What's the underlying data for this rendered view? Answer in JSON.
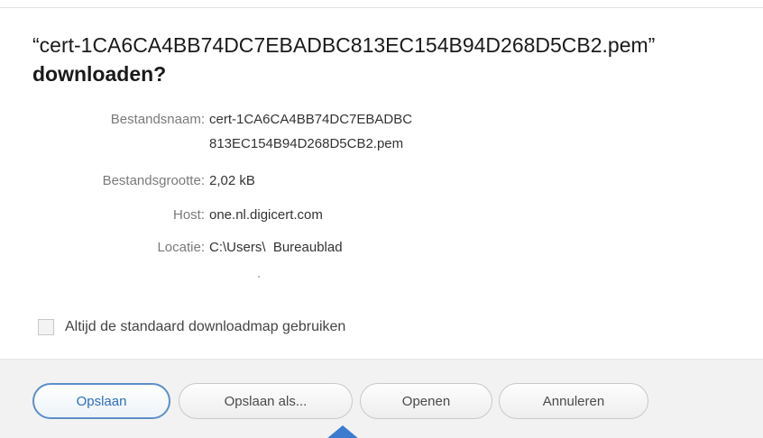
{
  "dialog": {
    "title_line1": "“cert-1CA6CA4BB74DC7EBADBC813EC154B94D268D5CB2.pem”",
    "title_line2": "downloaden?"
  },
  "fields": {
    "filename": {
      "label": "Bestandsnaam:",
      "value_line1": "cert-1CA6CA4BB74DC7EBADBC",
      "value_line2": "813EC154B94D268D5CB2.pem"
    },
    "filesize": {
      "label": "Bestandsgrootte:",
      "value": "2,02 kB"
    },
    "host": {
      "label": "Host:",
      "value": "one.nl.digicert.com"
    },
    "location": {
      "label": "Locatie:",
      "value": "C:\\Users\\  Bureaublad"
    }
  },
  "options": {
    "always_default_folder_label": "Altijd de standaard downloadmap gebruiken",
    "always_default_folder_checked": false
  },
  "buttons": {
    "save": "Opslaan",
    "save_as": "Opslaan als...",
    "open": "Openen",
    "cancel": "Annuleren"
  },
  "colors": {
    "primary_button_border": "#5b8fc9",
    "pointer_arrow": "#3d7bd1"
  },
  "icons": {
    "pointer": "pointer-arrow-icon"
  }
}
